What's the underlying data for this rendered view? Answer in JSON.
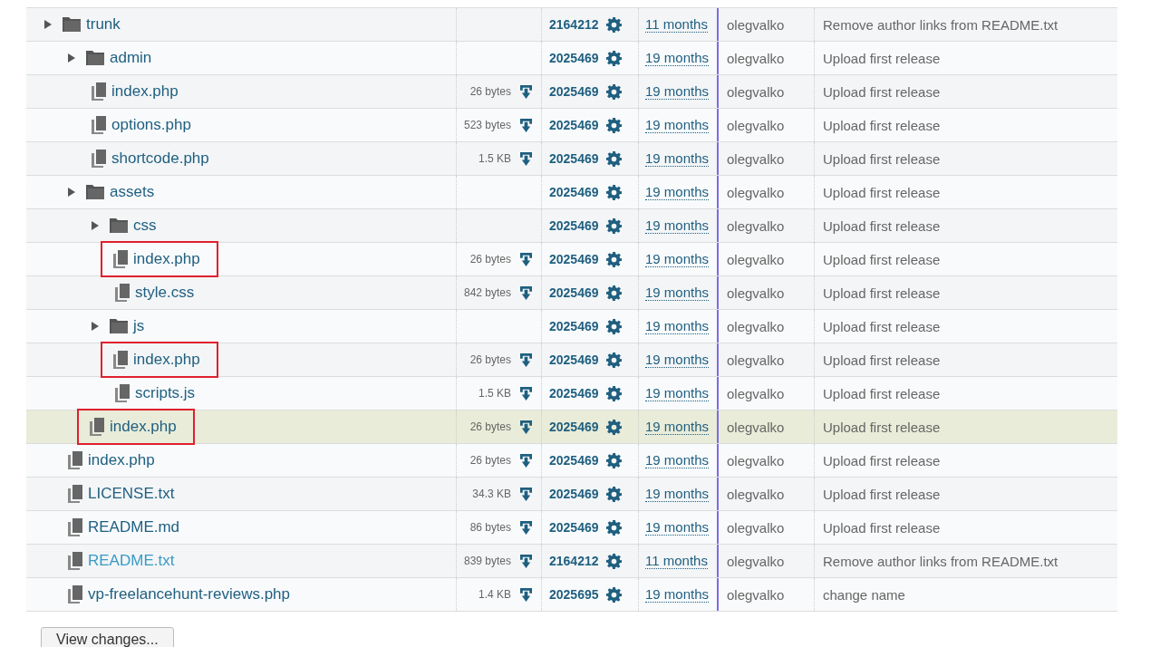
{
  "tree": [
    {
      "kind": "folder",
      "name": "trunk",
      "revision": "2164212",
      "age": "11 months",
      "author": "olegvalko",
      "message": "Remove author links from README.txt",
      "marked": false,
      "selected": false,
      "visited": false,
      "children": [
        {
          "kind": "folder",
          "name": "admin",
          "revision": "2025469",
          "age": "19 months",
          "author": "olegvalko",
          "message": "Upload first release",
          "marked": false,
          "selected": false,
          "visited": false,
          "children": [
            {
              "kind": "file",
              "name": "index.php",
              "size": "26 bytes",
              "revision": "2025469",
              "age": "19 months",
              "author": "olegvalko",
              "message": "Upload first release",
              "marked": false,
              "selected": false,
              "visited": false
            },
            {
              "kind": "file",
              "name": "options.php",
              "size": "523 bytes",
              "revision": "2025469",
              "age": "19 months",
              "author": "olegvalko",
              "message": "Upload first release",
              "marked": false,
              "selected": false,
              "visited": false
            },
            {
              "kind": "file",
              "name": "shortcode.php",
              "size": "1.5 KB",
              "revision": "2025469",
              "age": "19 months",
              "author": "olegvalko",
              "message": "Upload first release",
              "marked": false,
              "selected": false,
              "visited": false
            }
          ]
        },
        {
          "kind": "folder",
          "name": "assets",
          "revision": "2025469",
          "age": "19 months",
          "author": "olegvalko",
          "message": "Upload first release",
          "marked": false,
          "selected": false,
          "visited": false,
          "children": [
            {
              "kind": "folder",
              "name": "css",
              "revision": "2025469",
              "age": "19 months",
              "author": "olegvalko",
              "message": "Upload first release",
              "marked": false,
              "selected": false,
              "visited": false,
              "children": [
                {
                  "kind": "file",
                  "name": "index.php",
                  "size": "26 bytes",
                  "revision": "2025469",
                  "age": "19 months",
                  "author": "olegvalko",
                  "message": "Upload first release",
                  "marked": true,
                  "selected": false,
                  "visited": false
                },
                {
                  "kind": "file",
                  "name": "style.css",
                  "size": "842 bytes",
                  "revision": "2025469",
                  "age": "19 months",
                  "author": "olegvalko",
                  "message": "Upload first release",
                  "marked": false,
                  "selected": false,
                  "visited": false
                }
              ]
            },
            {
              "kind": "folder",
              "name": "js",
              "revision": "2025469",
              "age": "19 months",
              "author": "olegvalko",
              "message": "Upload first release",
              "marked": false,
              "selected": false,
              "visited": false,
              "children": [
                {
                  "kind": "file",
                  "name": "index.php",
                  "size": "26 bytes",
                  "revision": "2025469",
                  "age": "19 months",
                  "author": "olegvalko",
                  "message": "Upload first release",
                  "marked": true,
                  "selected": false,
                  "visited": false
                },
                {
                  "kind": "file",
                  "name": "scripts.js",
                  "size": "1.5 KB",
                  "revision": "2025469",
                  "age": "19 months",
                  "author": "olegvalko",
                  "message": "Upload first release",
                  "marked": false,
                  "selected": false,
                  "visited": false
                }
              ]
            },
            {
              "kind": "file",
              "name": "index.php",
              "size": "26 bytes",
              "revision": "2025469",
              "age": "19 months",
              "author": "olegvalko",
              "message": "Upload first release",
              "marked": true,
              "selected": true,
              "visited": false
            }
          ]
        },
        {
          "kind": "file",
          "name": "index.php",
          "size": "26 bytes",
          "revision": "2025469",
          "age": "19 months",
          "author": "olegvalko",
          "message": "Upload first release",
          "marked": false,
          "selected": false,
          "visited": false
        },
        {
          "kind": "file",
          "name": "LICENSE.txt",
          "size": "34.3 KB",
          "revision": "2025469",
          "age": "19 months",
          "author": "olegvalko",
          "message": "Upload first release",
          "marked": false,
          "selected": false,
          "visited": false
        },
        {
          "kind": "file",
          "name": "README.md",
          "size": "86 bytes",
          "revision": "2025469",
          "age": "19 months",
          "author": "olegvalko",
          "message": "Upload first release",
          "marked": false,
          "selected": false,
          "visited": false
        },
        {
          "kind": "file",
          "name": "README.txt",
          "size": "839 bytes",
          "revision": "2164212",
          "age": "11 months",
          "author": "olegvalko",
          "message": "Remove author links from README.txt",
          "marked": false,
          "selected": false,
          "visited": true
        },
        {
          "kind": "file",
          "name": "vp-freelancehunt-reviews.php",
          "size": "1.4 KB",
          "revision": "2025695",
          "age": "19 months",
          "author": "olegvalko",
          "message": "change name",
          "marked": false,
          "selected": false,
          "visited": false
        }
      ]
    }
  ],
  "button": "View changes..."
}
